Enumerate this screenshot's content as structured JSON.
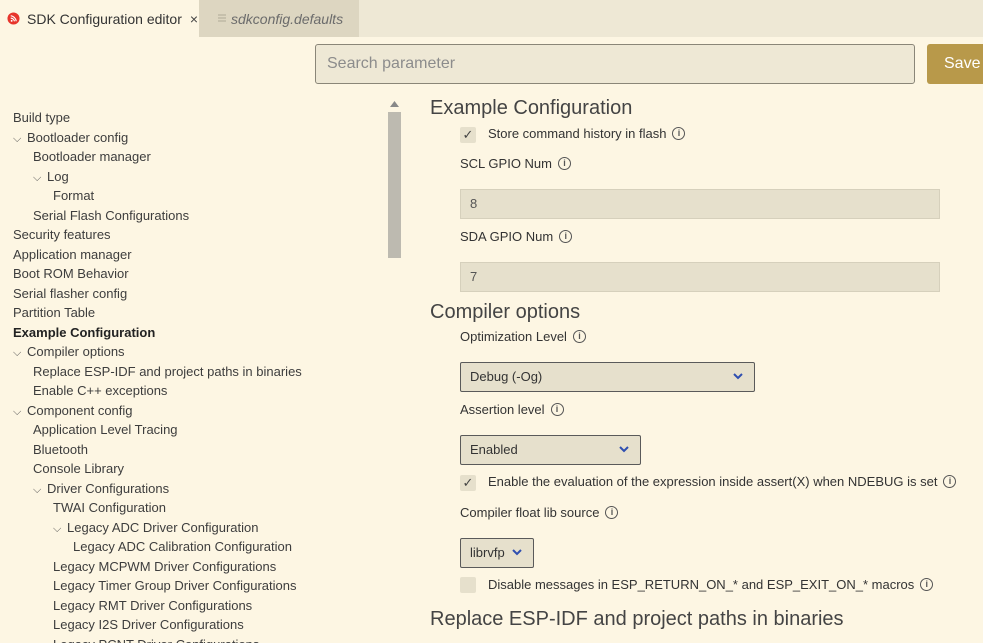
{
  "tabs": [
    {
      "label": "SDK Configuration editor",
      "close": "×"
    },
    {
      "label": "sdkconfig.defaults"
    }
  ],
  "search": {
    "placeholder": "Search parameter"
  },
  "save_label": "Save",
  "tree": [
    {
      "label": "Build type"
    },
    {
      "label": "Bootloader config",
      "chevron": "⌵"
    },
    {
      "label": "Bootloader manager"
    },
    {
      "label": "Log",
      "chevron": "⌵"
    },
    {
      "label": "Format"
    },
    {
      "label": "Serial Flash Configurations"
    },
    {
      "label": "Security features"
    },
    {
      "label": "Application manager"
    },
    {
      "label": "Boot ROM Behavior"
    },
    {
      "label": "Serial flasher config"
    },
    {
      "label": "Partition Table"
    },
    {
      "label": "Example Configuration"
    },
    {
      "label": "Compiler options",
      "chevron": "⌵"
    },
    {
      "label": "Replace ESP-IDF and project paths in binaries"
    },
    {
      "label": "Enable C++ exceptions"
    },
    {
      "label": "Component config",
      "chevron": "⌵"
    },
    {
      "label": "Application Level Tracing"
    },
    {
      "label": "Bluetooth"
    },
    {
      "label": "Console Library"
    },
    {
      "label": "Driver Configurations",
      "chevron": "⌵"
    },
    {
      "label": "TWAI Configuration"
    },
    {
      "label": "Legacy ADC Driver Configuration",
      "chevron": "⌵"
    },
    {
      "label": "Legacy ADC Calibration Configuration"
    },
    {
      "label": "Legacy MCPWM Driver Configurations"
    },
    {
      "label": "Legacy Timer Group Driver Configurations"
    },
    {
      "label": "Legacy RMT Driver Configurations"
    },
    {
      "label": "Legacy I2S Driver Configurations"
    },
    {
      "label": "Legacy PCNT Driver Configurations"
    }
  ],
  "content": {
    "example": {
      "title": "Example Configuration",
      "store_history": {
        "label": "Store command history in flash",
        "checked_mark": "✓"
      },
      "scl": {
        "label": "SCL GPIO Num",
        "value": "8"
      },
      "sda": {
        "label": "SDA GPIO Num",
        "value": "7"
      }
    },
    "compiler": {
      "title": "Compiler options",
      "optimization": {
        "label": "Optimization Level",
        "value": "Debug (-Og)"
      },
      "assertion": {
        "label": "Assertion level",
        "value": "Enabled"
      },
      "eval_assert": {
        "label": "Enable the evaluation of the expression inside assert(X) when NDEBUG is set",
        "checked_mark": "✓"
      },
      "float_lib": {
        "label": "Compiler float lib source",
        "value": "librvfp"
      },
      "disable_msgs": {
        "label": "Disable messages in ESP_RETURN_ON_* and ESP_EXIT_ON_* macros"
      }
    },
    "replace": {
      "title": "Replace ESP-IDF and project paths in binaries"
    }
  },
  "info_glyph": "i",
  "colors": {
    "background": "#fdf6e3",
    "accent": "#b8994a",
    "input_bg": "#e6e0cc",
    "caret": "#2f4fb0"
  }
}
